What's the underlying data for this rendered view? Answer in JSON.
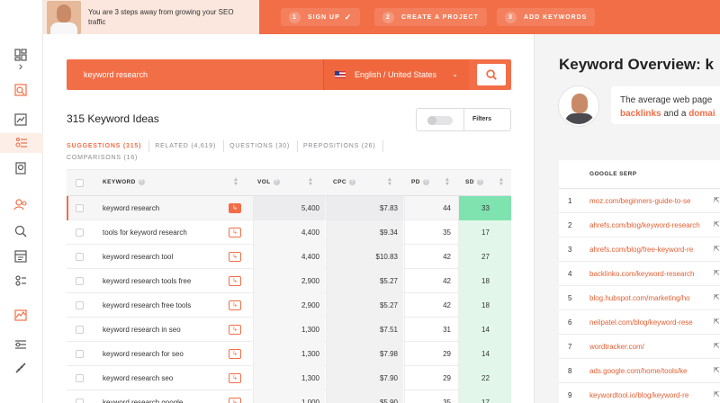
{
  "banner": {
    "promo_text": "You are 3 steps away from growing your SEO traffic",
    "steps": [
      {
        "num": "1",
        "label": "SIGN UP",
        "done": true
      },
      {
        "num": "2",
        "label": "CREATE A PROJECT",
        "done": false
      },
      {
        "num": "3",
        "label": "ADD KEYWORDS",
        "done": false
      }
    ],
    "check_glyph": "✓"
  },
  "sidebar": {
    "collapse_glyph": "›",
    "icons": [
      "expand-icon",
      "dashboard-icon",
      "site-audit-icon",
      "traffic-analyzer-icon",
      "keyword-ideas-icon",
      "backlinks-icon",
      "rank-tracker-icon",
      "keyword-research-icon",
      "content-ideas-icon",
      "seo-analyzer-icon",
      "traffic-overview-icon",
      "chrome-extension-icon",
      "settings-icon"
    ]
  },
  "search": {
    "query": "keyword research",
    "language": "English / United States",
    "chevron": "⌄"
  },
  "ideas": {
    "title": "315 Keyword Ideas",
    "filters_label": "Filters",
    "tabs": [
      {
        "label": "SUGGESTIONS (315)",
        "active": true
      },
      {
        "label": "RELATED (4,619)",
        "active": false
      },
      {
        "label": "QUESTIONS (30)",
        "active": false
      },
      {
        "label": "PREPOSITIONS (26)",
        "active": false
      },
      {
        "label": "COMPARISONS (16)",
        "active": false
      }
    ]
  },
  "table": {
    "headers": {
      "keyword": "KEYWORD",
      "vol": "VOL",
      "cpc": "CPC",
      "pd": "PD",
      "sd": "SD"
    },
    "help_glyph": "?",
    "link_glyph": "↳",
    "rows": [
      {
        "keyword": "keyword research",
        "vol": "5,400",
        "cpc": "$7.83",
        "pd": "44",
        "sd": "33",
        "selected": true
      },
      {
        "keyword": "tools for keyword research",
        "vol": "4,400",
        "cpc": "$9.34",
        "pd": "35",
        "sd": "17",
        "selected": false
      },
      {
        "keyword": "keyword research tool",
        "vol": "4,400",
        "cpc": "$10.83",
        "pd": "42",
        "sd": "27",
        "selected": false
      },
      {
        "keyword": "keyword research tools free",
        "vol": "2,900",
        "cpc": "$5.27",
        "pd": "42",
        "sd": "18",
        "selected": false
      },
      {
        "keyword": "keyword research free tools",
        "vol": "2,900",
        "cpc": "$5.27",
        "pd": "42",
        "sd": "18",
        "selected": false
      },
      {
        "keyword": "keyword research in seo",
        "vol": "1,300",
        "cpc": "$7.51",
        "pd": "31",
        "sd": "14",
        "selected": false
      },
      {
        "keyword": "keyword research for seo",
        "vol": "1,300",
        "cpc": "$7.98",
        "pd": "29",
        "sd": "14",
        "selected": false
      },
      {
        "keyword": "keyword research seo",
        "vol": "1,300",
        "cpc": "$7.90",
        "pd": "29",
        "sd": "22",
        "selected": false
      },
      {
        "keyword": "keyword research google",
        "vol": "1,000",
        "cpc": "$5.90",
        "pd": "35",
        "sd": "17",
        "selected": false
      }
    ],
    "sd_colors": {
      "high": "#7fe3b0",
      "low": "#e2f7ea"
    }
  },
  "overview": {
    "title": "Keyword Overview: k",
    "bubble_line1": "The average web page",
    "bubble_line2_link1": "backlinks",
    "bubble_line2_mid": " and a ",
    "bubble_line2_link2": "domai",
    "serp_header": "GOOGLE SERP",
    "ext_glyph": "⇱",
    "serp": [
      {
        "rank": "1",
        "url": "moz.com/beginners-guide-to-se"
      },
      {
        "rank": "2",
        "url": "ahrefs.com/blog/keyword-research"
      },
      {
        "rank": "3",
        "url": "ahrefs.com/blog/free-keyword-re"
      },
      {
        "rank": "4",
        "url": "backlinko.com/keyword-research"
      },
      {
        "rank": "5",
        "url": "blog.hubspot.com/marketing/ho"
      },
      {
        "rank": "6",
        "url": "neilpatel.com/blog/keyword-rese"
      },
      {
        "rank": "7",
        "url": "wordtracker.com/"
      },
      {
        "rank": "8",
        "url": "ads.google.com/home/tools/ke"
      },
      {
        "rank": "9",
        "url": "keywordtool.io/blog/keyword-re"
      }
    ]
  },
  "colors": {
    "accent": "#f26e47",
    "link": "#e15f33"
  }
}
